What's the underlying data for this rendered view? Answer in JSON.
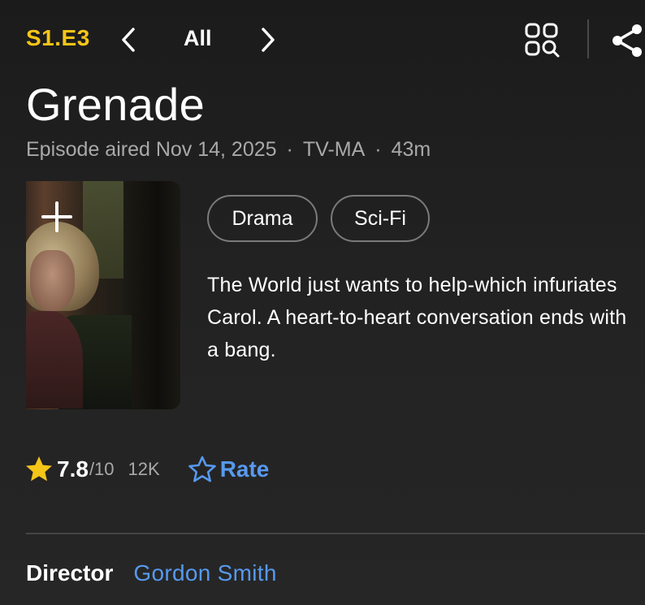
{
  "episode_nav": {
    "episode_code": "S1.E3",
    "all_label": "All",
    "icons": {
      "prev": "chevron-left-icon",
      "next": "chevron-right-icon",
      "grid_search": "grid-search-icon",
      "share": "share-icon"
    }
  },
  "episode": {
    "title": "Grenade",
    "aired": "Episode aired Nov 14, 2025",
    "separator": "·",
    "rating_cert": "TV-MA",
    "runtime": "43m"
  },
  "poster": {
    "add_icon": "plus-icon"
  },
  "genres": [
    "Drama",
    "Sci-Fi"
  ],
  "plot": "The World just wants to help-which infuriates Carol. A heart-to-heart conversation ends with a bang.",
  "rating": {
    "score": "7.8",
    "out_of": "/10",
    "votes": "12K",
    "rate_label": "Rate",
    "star_color": "#f5c518",
    "rate_color": "#5799ef"
  },
  "credits": {
    "director_label": "Director",
    "director_name": "Gordon Smith"
  },
  "colors": {
    "accent": "#f5c518",
    "link": "#5799ef",
    "background": "#1f1f1f"
  }
}
